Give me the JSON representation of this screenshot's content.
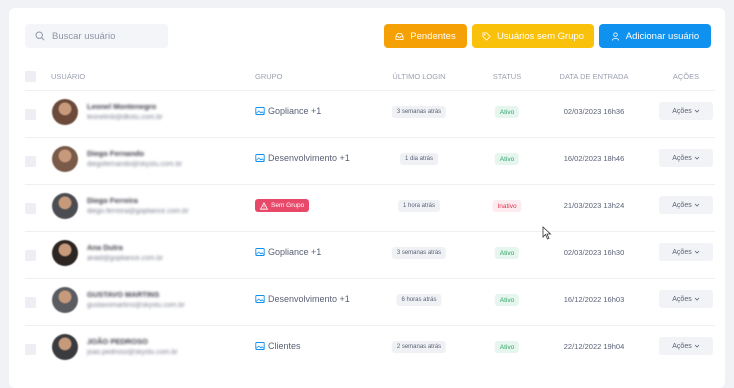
{
  "search": {
    "placeholder": "Buscar usuário"
  },
  "buttons": {
    "pendentes": "Pendentes",
    "sem_grupo": "Usuários sem Grupo",
    "adicionar": "Adicionar usuário"
  },
  "columns": {
    "usuario": "USUÁRIO",
    "grupo": "GRUPO",
    "ultimo_login": "ÚLTIMO LOGIN",
    "status": "STATUS",
    "data_entrada": "DATA DE ENTRADA",
    "acoes": "AÇÕES"
  },
  "icons": {
    "search": "search-icon",
    "pendentes": "inbox-icon",
    "sem_grupo": "tag-icon",
    "adicionar": "user-icon",
    "group": "image-icon",
    "warning": "warning-icon",
    "chevron": "chevron-down-icon"
  },
  "colors": {
    "pendentes": "#f5a105",
    "sem_grupo": "#f9c10a",
    "adicionar": "#0f91f0",
    "sem_grupo_badge": "#e8496a",
    "ativo": "#2fa56a",
    "inativo": "#e2304f"
  },
  "rows": [
    {
      "name": "Leonel Montenegro",
      "email": "leonelmb@dkstu.com.br",
      "group": "Gopliance +1",
      "no_group": false,
      "last_login": "3 semanas atrás",
      "status": "Ativo",
      "status_type": "ativo",
      "date": "02/03/2023 16h36",
      "actions": "Ações"
    },
    {
      "name": "Diego Fernando",
      "email": "diegofernando@skystu.com.br",
      "group": "Desenvolvimento +1",
      "no_group": false,
      "last_login": "1 dia atrás",
      "status": "Ativo",
      "status_type": "ativo",
      "date": "16/02/2023 18h46",
      "actions": "Ações"
    },
    {
      "name": "Diego Ferreira",
      "email": "diego.ferreira@gopliance.com.br",
      "group": "Sem Grupo",
      "no_group": true,
      "last_login": "1 hora atrás",
      "status": "Inativo",
      "status_type": "inativo",
      "date": "21/03/2023 13h24",
      "actions": "Ações"
    },
    {
      "name": "Ana Dutra",
      "email": "anad@gopliance.com.br",
      "group": "Gopliance +1",
      "no_group": false,
      "last_login": "3 semanas atrás",
      "status": "Ativo",
      "status_type": "ativo",
      "date": "02/03/2023 16h30",
      "actions": "Ações"
    },
    {
      "name": "GUSTAVO MARTINS",
      "email": "gustavomartins@skystu.com.br",
      "group": "Desenvolvimento +1",
      "no_group": false,
      "last_login": "6 horas atrás",
      "status": "Ativo",
      "status_type": "ativo",
      "date": "16/12/2022 16h03",
      "actions": "Ações"
    },
    {
      "name": "JOÃO PEDROSO",
      "email": "joao.pedroso@skystu.com.br",
      "group": "Clientes",
      "no_group": false,
      "last_login": "2 semanas atrás",
      "status": "Ativo",
      "status_type": "ativo",
      "date": "22/12/2022 19h04",
      "actions": "Ações"
    }
  ]
}
